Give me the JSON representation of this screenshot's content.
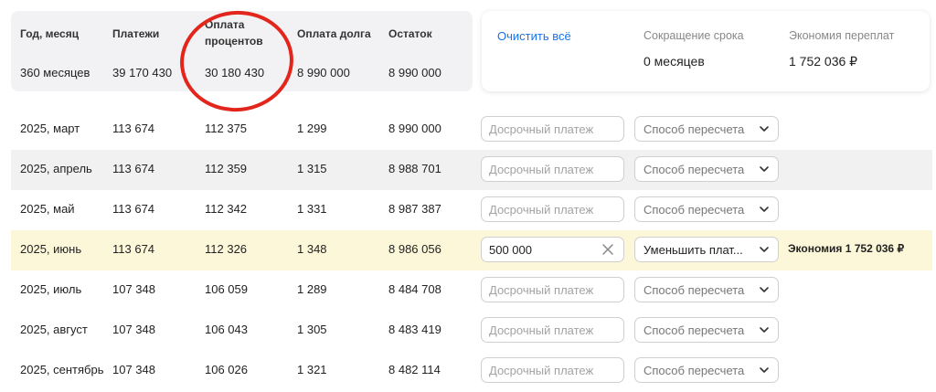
{
  "summary": {
    "headers": [
      "Год, месяц",
      "Платежи",
      "Оплата процентов",
      "Оплата долга",
      "Остаток"
    ],
    "interest_header_line1": "Оплата",
    "interest_header_line2": "процентов",
    "values": [
      "360 месяцев",
      "39 170 430",
      "30 180 430",
      "8 990 000",
      "8 990 000"
    ]
  },
  "side_panel": {
    "clear_label": "Очистить всё",
    "term_label": "Сокращение срока",
    "term_value": "0 месяцев",
    "savings_label": "Экономия переплат",
    "savings_value": "1 752 036 ₽"
  },
  "rows": [
    {
      "month": "2025, март",
      "payment": "113 674",
      "interest": "112 375",
      "principal": "1 299",
      "balance": "8 990 000",
      "early": "",
      "method": "Способ пересчета",
      "note": ""
    },
    {
      "month": "2025, апрель",
      "payment": "113 674",
      "interest": "112 359",
      "principal": "1 315",
      "balance": "8 988 701",
      "early": "",
      "method": "Способ пересчета",
      "note": ""
    },
    {
      "month": "2025, май",
      "payment": "113 674",
      "interest": "112 342",
      "principal": "1 331",
      "balance": "8 987 387",
      "early": "",
      "method": "Способ пересчета",
      "note": ""
    },
    {
      "month": "2025, июнь",
      "payment": "113 674",
      "interest": "112 326",
      "principal": "1 348",
      "balance": "8 986 056",
      "early": "500 000",
      "method": "Уменьшить плат...",
      "note": "Экономия 1 752 036 ₽"
    },
    {
      "month": "2025, июль",
      "payment": "107 348",
      "interest": "106 059",
      "principal": "1 289",
      "balance": "8 484 708",
      "early": "",
      "method": "Способ пересчета",
      "note": ""
    },
    {
      "month": "2025, август",
      "payment": "107 348",
      "interest": "106 043",
      "principal": "1 305",
      "balance": "8 483 419",
      "early": "",
      "method": "Способ пересчета",
      "note": ""
    },
    {
      "month": "2025, сентябрь",
      "payment": "107 348",
      "interest": "106 026",
      "principal": "1 321",
      "balance": "8 482 114",
      "early": "",
      "method": "Способ пересчета",
      "note": ""
    }
  ],
  "early_payment_placeholder": "Досрочный платеж",
  "colors": {
    "highlight_row": "#fdf7d9",
    "alt_row": "#f1f1f1",
    "link": "#1a73e8",
    "annotation": "#e3261c"
  },
  "icons": {
    "clear": "close-icon",
    "dropdown": "chevron-down-icon"
  }
}
